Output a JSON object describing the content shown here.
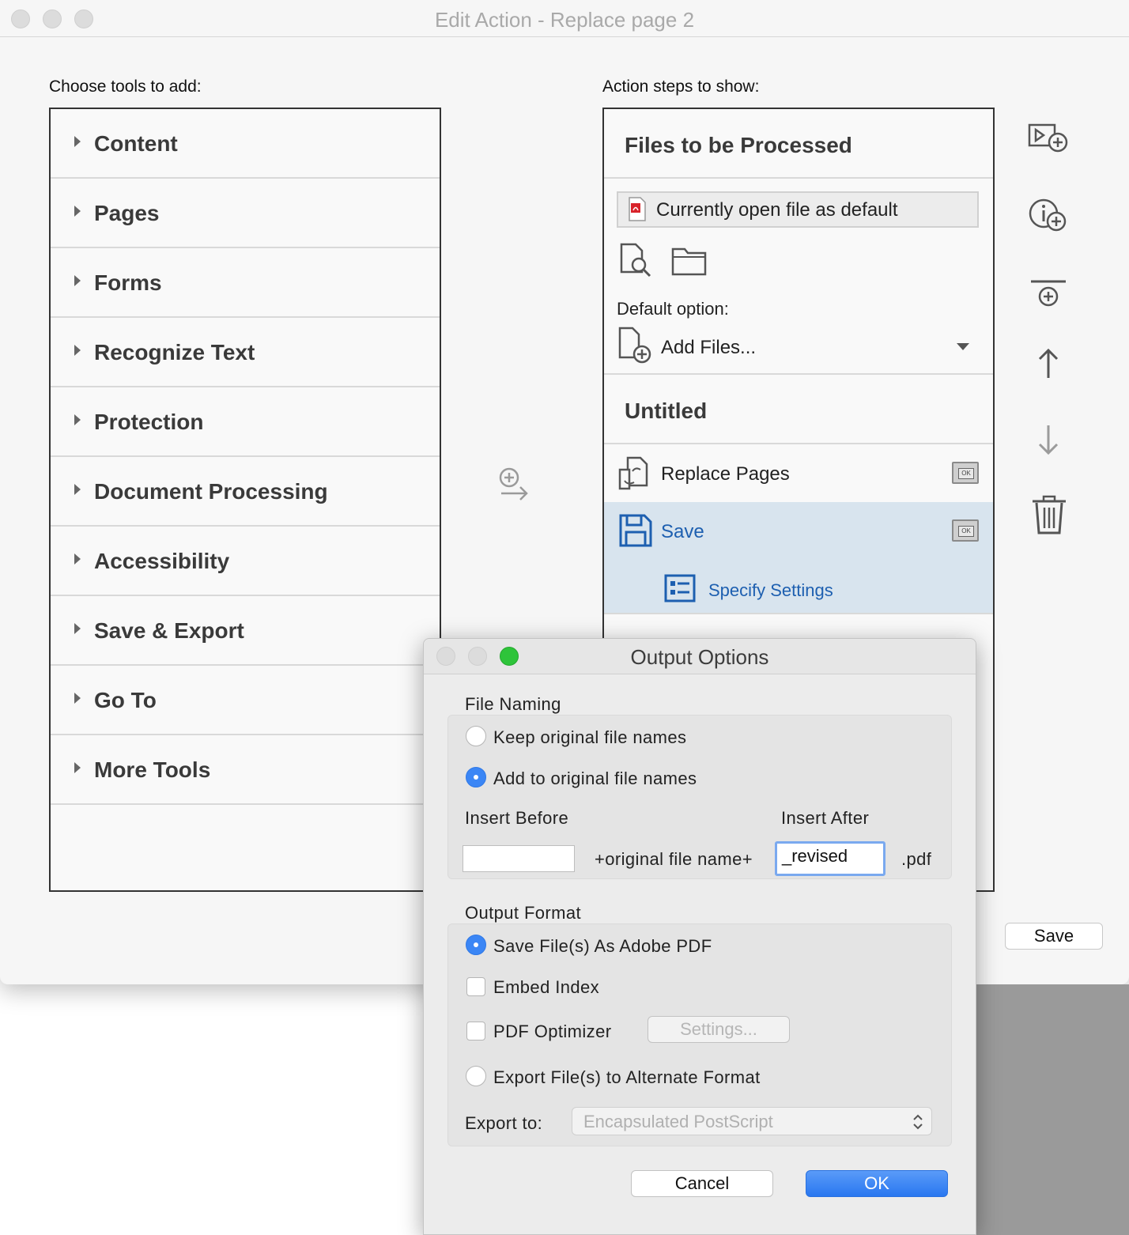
{
  "window": {
    "title": "Edit Action - Replace page 2"
  },
  "left_panel": {
    "label": "Choose tools to add:",
    "tools": [
      {
        "label": "Content"
      },
      {
        "label": "Pages"
      },
      {
        "label": "Forms"
      },
      {
        "label": "Recognize Text"
      },
      {
        "label": "Protection"
      },
      {
        "label": "Document Processing"
      },
      {
        "label": "Accessibility"
      },
      {
        "label": "Save & Export"
      },
      {
        "label": "Go To"
      },
      {
        "label": "More Tools"
      }
    ]
  },
  "right_panel": {
    "label": "Action steps to show:",
    "files_header": "Files to be Processed",
    "file_field": "Currently open file as default",
    "default_option_label": "Default option:",
    "default_option_value": "Add Files...",
    "section_title": "Untitled",
    "steps": [
      {
        "label": "Replace Pages",
        "icon": "replace-pages-icon"
      },
      {
        "label": "Save",
        "icon": "save-disk-icon"
      }
    ],
    "sub_step": "Specify Settings"
  },
  "main_save_button": "Save",
  "dialog": {
    "title": "Output Options",
    "file_naming": {
      "label": "File Naming",
      "keep_original": "Keep original file names",
      "add_to_original": "Add to original file names",
      "selected": "add_to_original",
      "insert_before_label": "Insert Before",
      "insert_after_label": "Insert After",
      "insert_before_value": "",
      "middle_text": "+original file name+",
      "insert_after_value": "_revised",
      "extension": ".pdf"
    },
    "output_format": {
      "label": "Output Format",
      "save_as_pdf": "Save File(s) As Adobe PDF",
      "embed_index": "Embed Index",
      "pdf_optimizer": "PDF Optimizer",
      "settings_button": "Settings...",
      "export_alt": "Export File(s) to Alternate Format",
      "export_to_label": "Export to:",
      "export_to_value": "Encapsulated PostScript",
      "selected": "save_as_pdf",
      "embed_index_checked": false,
      "pdf_optimizer_checked": false
    },
    "cancel_button": "Cancel",
    "ok_button": "OK"
  },
  "colors": {
    "accent_blue": "#2977f0",
    "save_blue": "#1d5fb0",
    "selection_bg": "#d8e4ee",
    "traffic_green": "#2ec43a"
  }
}
